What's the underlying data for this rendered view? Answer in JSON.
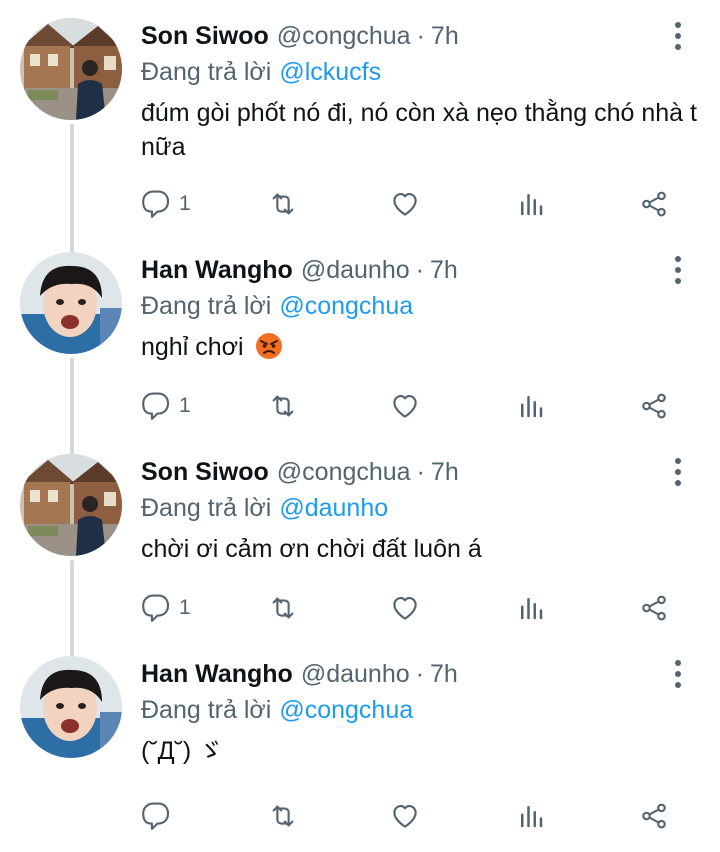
{
  "tweets": [
    {
      "name": "Son Siwoo",
      "handle": "@congchua",
      "dot": "·",
      "time": "7h",
      "replying_prefix": "Đang trả lời",
      "replying_to": "@lckucfs",
      "text": "đúm gòi phốt nó đi, nó còn xà nẹo thằng chó nhà t nữa",
      "reply_count": "1",
      "avatar": "photo-street-avatar"
    },
    {
      "name": "Han Wangho",
      "handle": "@daunho",
      "dot": "·",
      "time": "7h",
      "replying_prefix": "Đang trả lời",
      "replying_to": "@congchua",
      "text": "nghỉ chơi",
      "emoji": "angry-face-icon",
      "reply_count": "1",
      "avatar": "photo-face-avatar"
    },
    {
      "name": "Son Siwoo",
      "handle": "@congchua",
      "dot": "·",
      "time": "7h",
      "replying_prefix": "Đang trả lời",
      "replying_to": "@daunho",
      "text": "chời ơi cảm ơn chời đất luôn á",
      "reply_count": "1",
      "avatar": "photo-street-avatar"
    },
    {
      "name": "Han Wangho",
      "handle": "@daunho",
      "dot": "·",
      "time": "7h",
      "replying_prefix": "Đang trả lời",
      "replying_to": "@congchua",
      "text": "(˘Д˘) ゞ",
      "reply_count": "",
      "avatar": "photo-face-avatar"
    }
  ],
  "colors": {
    "text": "#0f1419",
    "secondary": "#536471",
    "link": "#1d9bf0",
    "thread_line": "#cfd9de"
  },
  "icons": [
    "reply-icon",
    "retweet-icon",
    "like-icon",
    "views-icon",
    "share-icon",
    "more-options-icon"
  ]
}
